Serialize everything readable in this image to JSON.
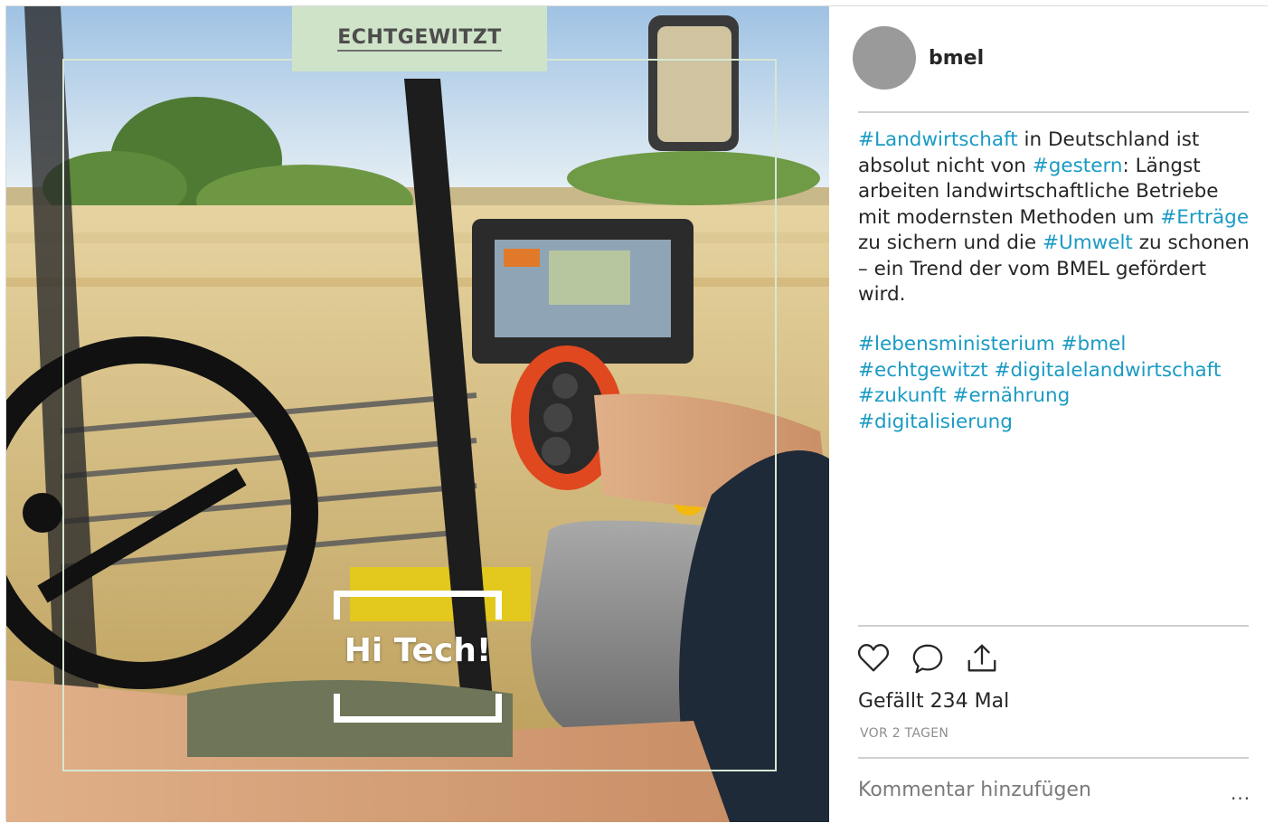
{
  "post": {
    "image": {
      "brand_tab": "ECHTGEWITZT",
      "overlay_label": "Hi Tech!"
    },
    "header": {
      "username": "bmel"
    },
    "caption": {
      "tag_landwirtschaft": "#Landwirtschaft",
      "text_1": " in Deutschland ist absolut nicht von ",
      "tag_gestern": "#gestern",
      "text_2": ": Längst arbeiten landwirtschaftliche Betriebe mit modernsten Methoden um ",
      "tag_ertraege": "#Erträge",
      "text_3": " zu sichern und die ",
      "tag_umwelt": "#Umwelt",
      "text_4": " zu schonen – ein Trend der vom BMEL gefördert wird."
    },
    "hashtags": [
      "#lebensministerium",
      "#bmel",
      "#echtgewitzt",
      "#digitalelandwirtschaft",
      "#zukunft",
      "#ernährung",
      "#digitalisierung"
    ],
    "actions": {
      "like_icon": "heart-icon",
      "comment_icon": "comment-icon",
      "share_icon": "share-icon"
    },
    "likes_text": "Gefällt 234 Mal",
    "time_text": "VOR 2 TAGEN",
    "comment_placeholder": "Kommentar hinzufügen",
    "more_label": "...",
    "colors": {
      "hashtag": "#1a9bc4",
      "brand_tab_bg": "#cfe3c9",
      "avatar": "#9a9a9a"
    }
  }
}
